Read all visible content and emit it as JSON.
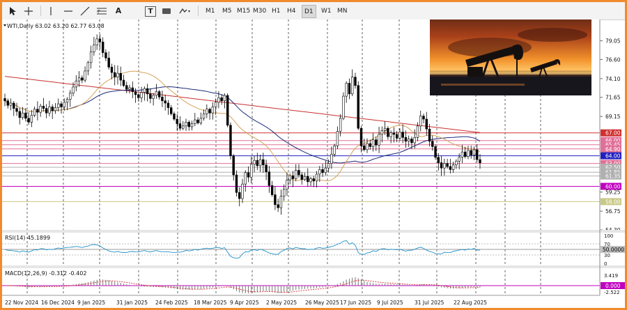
{
  "toolbar": {
    "tools": [
      {
        "icon": "cursor-arrow-icon"
      },
      {
        "icon": "crosshair-icon"
      },
      {
        "icon": "vertical-line-icon"
      },
      {
        "icon": "horizontal-line-icon"
      },
      {
        "icon": "trendline-icon"
      },
      {
        "icon": "fibonacci-icon"
      },
      {
        "icon": "text-tool-icon",
        "label": "A"
      },
      {
        "icon": "text-label-icon",
        "label": "T"
      },
      {
        "icon": "rectangle-icon"
      },
      {
        "icon": "shapes-dropdown-icon"
      }
    ],
    "timeframes": [
      "M1",
      "M5",
      "M15",
      "M30",
      "H1",
      "H4",
      "D1",
      "W1",
      "MN"
    ],
    "active_timeframe": "D1"
  },
  "chart_data": [
    {
      "type": "candlestick",
      "title": "WTI,Daily  63.02 63.20 62.77 63.08",
      "ylim": [
        54.3,
        81.2
      ],
      "y_ticks": [
        "79.05",
        "76.60",
        "74.10",
        "71.65",
        "69.15",
        "59.25",
        "56.75",
        "54.30"
      ],
      "x_tick_labels": [
        "22 Nov 2024",
        "16 Dec 2024",
        "9 Jan 2025",
        "31 Jan 2025",
        "24 Feb 2025",
        "18 Mar 2025",
        "9 Apr 2025",
        "2 May 2025",
        "26 May 2025",
        "17 Jun 2025",
        "9 Jul 2025",
        "31 Jul 2025",
        "22 Aug 2025"
      ],
      "horizontal_levels": [
        {
          "value": 67.0,
          "label": "67.00",
          "color": "#d03030"
        },
        {
          "value": 66.0,
          "label": "66.00",
          "color": "#e07098"
        },
        {
          "value": 65.45,
          "label": "65.45",
          "color": "#e07098"
        },
        {
          "value": 64.9,
          "label": "64.90",
          "color": "#e07098"
        },
        {
          "value": 64.0,
          "label": "64.00",
          "color": "#2020c0"
        },
        {
          "value": 63.0,
          "label": "63.00",
          "color": "#e07098"
        },
        {
          "value": 62.5,
          "label": "62.50",
          "color": "#b0b0b0"
        },
        {
          "value": 61.85,
          "label": "61.85",
          "color": "#b0b0b0"
        },
        {
          "value": 61.35,
          "label": "61.35",
          "color": "#b0b0b0"
        },
        {
          "value": 60.0,
          "label": "60.00",
          "color": "#c000c0"
        },
        {
          "value": 58.0,
          "label": "58.00",
          "color": "#c8c888"
        }
      ],
      "close": [
        71.2,
        70.6,
        70.9,
        70.2,
        69.8,
        69.0,
        69.6,
        68.9,
        68.4,
        69.3,
        70.1,
        69.7,
        70.5,
        70.2,
        69.6,
        70.4,
        69.9,
        70.3,
        70.8,
        70.4,
        71.0,
        71.4,
        72.2,
        73.0,
        73.8,
        74.2,
        73.9,
        75.1,
        76.2,
        77.6,
        78.5,
        79.3,
        78.9,
        77.5,
        76.8,
        75.6,
        74.9,
        74.3,
        74.8,
        73.9,
        73.2,
        72.7,
        72.9,
        72.4,
        72.0,
        71.6,
        72.3,
        72.8,
        72.1,
        71.5,
        71.9,
        72.4,
        71.7,
        71.2,
        70.9,
        70.3,
        69.5,
        68.8,
        68.2,
        67.6,
        67.9,
        68.4,
        67.8,
        68.2,
        68.7,
        68.3,
        68.9,
        69.5,
        70.1,
        69.6,
        70.4,
        71.0,
        71.6,
        71.2,
        71.9,
        68.0,
        64.0,
        61.5,
        59.2,
        58.4,
        60.3,
        61.8,
        61.2,
        62.9,
        63.4,
        62.7,
        63.5,
        62.8,
        61.9,
        60.1,
        58.9,
        57.6,
        57.2,
        58.7,
        59.6,
        60.8,
        61.4,
        61.0,
        62.1,
        61.5,
        60.9,
        61.3,
        60.6,
        61.0,
        60.7,
        61.6,
        62.2,
        61.8,
        62.4,
        63.0,
        64.2,
        65.3,
        67.2,
        68.9,
        71.8,
        73.5,
        72.1,
        74.3,
        73.2,
        67.6,
        65.3,
        64.8,
        65.6,
        65.2,
        66.1,
        65.4,
        66.8,
        67.3,
        67.6,
        66.5,
        67.0,
        66.8,
        66.3,
        67.1,
        66.4,
        65.9,
        66.2,
        65.7,
        66.4,
        67.9,
        69.2,
        68.8,
        67.5,
        65.9,
        65.2,
        63.8,
        63.1,
        62.4,
        63.0,
        62.6,
        62.2,
        62.8,
        63.3,
        63.8,
        64.5,
        63.9,
        64.7,
        64.1,
        64.8,
        63.5,
        63.08
      ]
    },
    {
      "type": "line",
      "title": "RSI(14) 45.1899",
      "ylim": [
        0,
        100
      ],
      "y_ticks": [
        "100",
        "70",
        "30",
        "0"
      ],
      "level_label": "50.0000"
    },
    {
      "type": "histogram",
      "title": "MACD(12,26,9) -0.312 -0.402",
      "y_ticks": [
        "3.419",
        "-2.522"
      ],
      "level_label": "0.000"
    }
  ]
}
